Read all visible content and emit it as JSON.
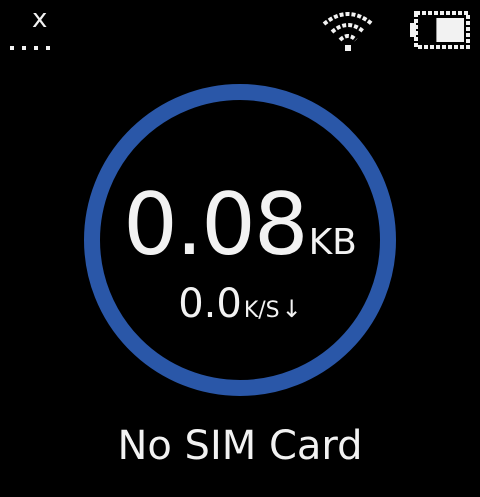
{
  "status_bar": {
    "signal_icon": "no-signal-icon",
    "signal_mark": "x",
    "wifi_icon": "wifi-icon",
    "battery_icon": "battery-icon",
    "battery_level": 0.6
  },
  "data_usage": {
    "value": "0.08",
    "unit": "KB"
  },
  "speed": {
    "value": "0.0",
    "unit": "K/S",
    "direction_icon": "download-arrow-icon",
    "direction_glyph": "↓"
  },
  "sim_status": "No SIM Card",
  "colors": {
    "background": "#000000",
    "ring": "#2a57a8",
    "text": "#f2f2f2"
  }
}
